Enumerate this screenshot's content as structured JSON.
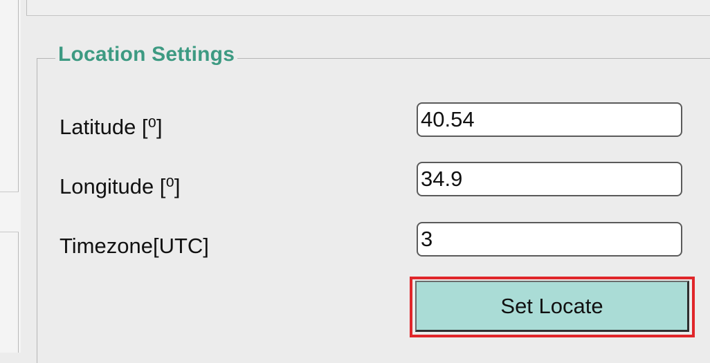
{
  "group": {
    "title": "Location Settings"
  },
  "fields": {
    "latitude": {
      "label": "Latitude [⁰]",
      "value": "40.54"
    },
    "longitude": {
      "label": "Longitude [⁰]",
      "value": "34.9"
    },
    "timezone": {
      "label": "Timezone[UTC]",
      "value": "3"
    }
  },
  "actions": {
    "set_locate_label": "Set Locate"
  },
  "colors": {
    "group_title": "#3d9a82",
    "button_bg": "#aadcd6",
    "highlight_border": "#e0262a"
  }
}
